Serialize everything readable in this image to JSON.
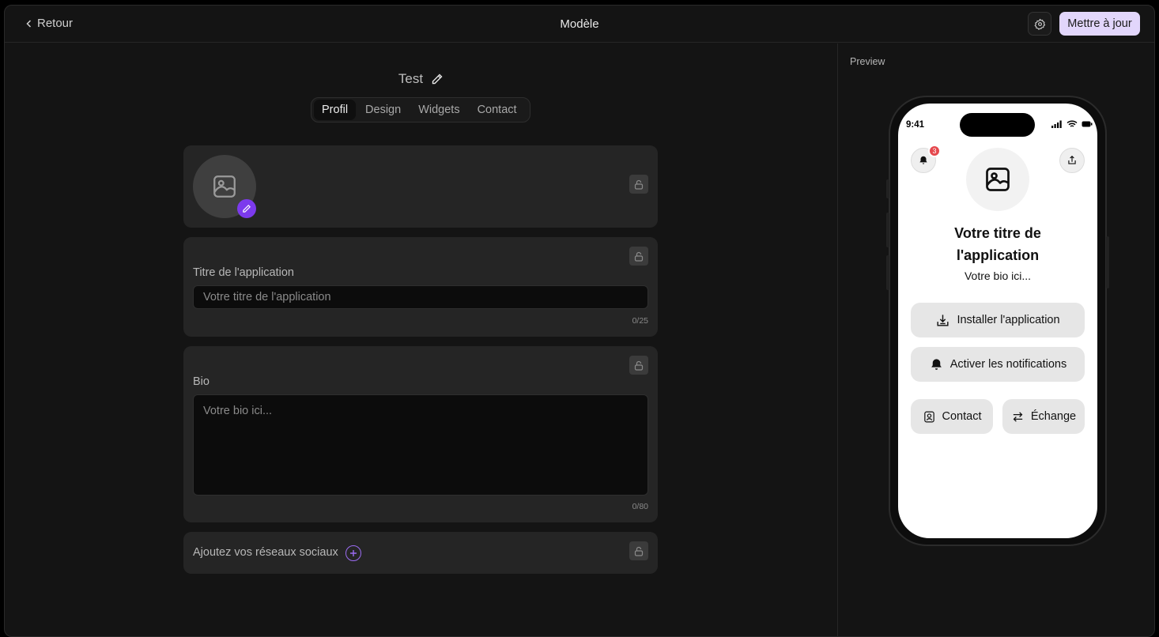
{
  "header": {
    "back_label": "Retour",
    "title": "Modèle",
    "settings_icon": "gear-icon",
    "update_label": "Mettre à jour",
    "update_color": "#e2d6fb"
  },
  "editor": {
    "project_name": "Test",
    "tabs": [
      {
        "label": "Profil",
        "active": true
      },
      {
        "label": "Design",
        "active": false
      },
      {
        "label": "Widgets",
        "active": false
      },
      {
        "label": "Contact",
        "active": false
      }
    ],
    "title_field": {
      "label": "Titre de l'application",
      "placeholder": "Votre titre de l'application",
      "counter": "0/25"
    },
    "bio_field": {
      "label": "Bio",
      "placeholder": "Votre bio ici...",
      "counter": "0/80"
    },
    "social": {
      "label": "Ajoutez vos réseaux sociaux"
    },
    "accent_color": "#7c3aed"
  },
  "preview": {
    "label": "Preview",
    "time": "9:41",
    "notification_count": "3",
    "app_title": "Votre titre de l'application",
    "bio": "Votre bio ici...",
    "install_label": "Installer l'application",
    "notifications_label": "Activer les notifications",
    "contact_label": "Contact",
    "exchange_label": "Échange"
  }
}
